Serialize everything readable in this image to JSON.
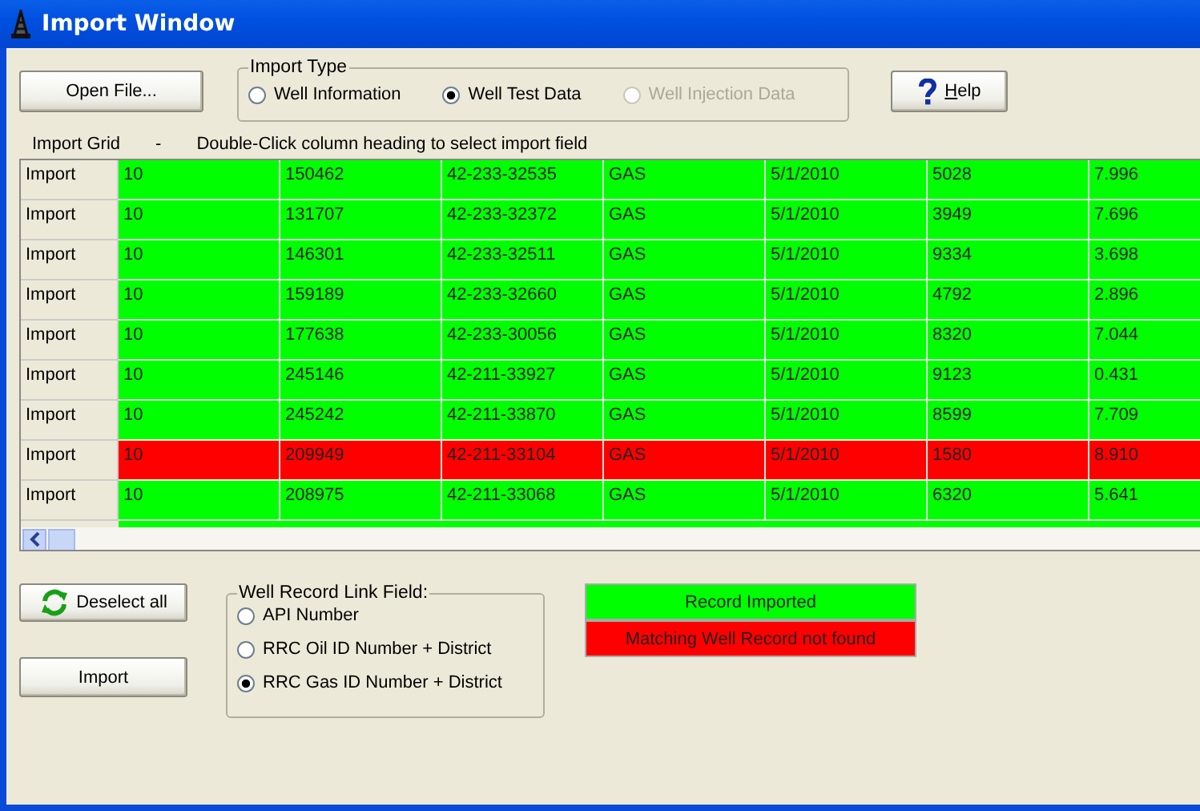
{
  "window": {
    "title": "Import Window"
  },
  "open_button": "Open File...",
  "import_type": {
    "legend": "Import Type",
    "options": [
      {
        "label": "Well Information",
        "selected": false,
        "disabled": false
      },
      {
        "label": "Well Test Data",
        "selected": true,
        "disabled": false
      },
      {
        "label": "Well Injection Data",
        "selected": false,
        "disabled": true
      }
    ]
  },
  "help_button": "Help",
  "grid_caption": {
    "title": "Import Grid",
    "separator": "-",
    "hint": "Double-Click column heading to select import field"
  },
  "grid": {
    "rows": [
      {
        "header": "Import",
        "color": "#00ff00",
        "cells": [
          "10",
          "150462",
          "42-233-32535",
          "GAS",
          "5/1/2010",
          "5028",
          "7.996"
        ]
      },
      {
        "header": "Import",
        "color": "#00ff00",
        "cells": [
          "10",
          "131707",
          "42-233-32372",
          "GAS",
          "5/1/2010",
          "3949",
          "7.696"
        ]
      },
      {
        "header": "Import",
        "color": "#00ff00",
        "cells": [
          "10",
          "146301",
          "42-233-32511",
          "GAS",
          "5/1/2010",
          "9334",
          "3.698"
        ]
      },
      {
        "header": "Import",
        "color": "#00ff00",
        "cells": [
          "10",
          "159189",
          "42-233-32660",
          "GAS",
          "5/1/2010",
          "4792",
          "2.896"
        ]
      },
      {
        "header": "Import",
        "color": "#00ff00",
        "cells": [
          "10",
          "177638",
          "42-233-30056",
          "GAS",
          "5/1/2010",
          "8320",
          "7.044"
        ]
      },
      {
        "header": "Import",
        "color": "#00ff00",
        "cells": [
          "10",
          "245146",
          "42-211-33927",
          "GAS",
          "5/1/2010",
          "9123",
          "0.431"
        ]
      },
      {
        "header": "Import",
        "color": "#00ff00",
        "cells": [
          "10",
          "245242",
          "42-211-33870",
          "GAS",
          "5/1/2010",
          "8599",
          "7.709"
        ]
      },
      {
        "header": "Import",
        "color": "#ff0000",
        "cells": [
          "10",
          "209949",
          "42-211-33104",
          "GAS",
          "5/1/2010",
          "1580",
          "8.910"
        ]
      },
      {
        "header": "Import",
        "color": "#00ff00",
        "cells": [
          "10",
          "208975",
          "42-211-33068",
          "GAS",
          "5/1/2010",
          "6320",
          "5.641"
        ]
      }
    ]
  },
  "deselect_button": "Deselect all",
  "import_button": "Import",
  "link_field": {
    "legend": "Well Record Link Field:",
    "options": [
      {
        "label": "API Number",
        "selected": false
      },
      {
        "label": "RRC Oil ID Number + District",
        "selected": false
      },
      {
        "label": "RRC Gas ID Number + District",
        "selected": true
      }
    ]
  },
  "legend": [
    {
      "label": "Record Imported",
      "color": "#00ff00"
    },
    {
      "label": "Matching Well Record not found",
      "color": "#ff0000"
    }
  ]
}
